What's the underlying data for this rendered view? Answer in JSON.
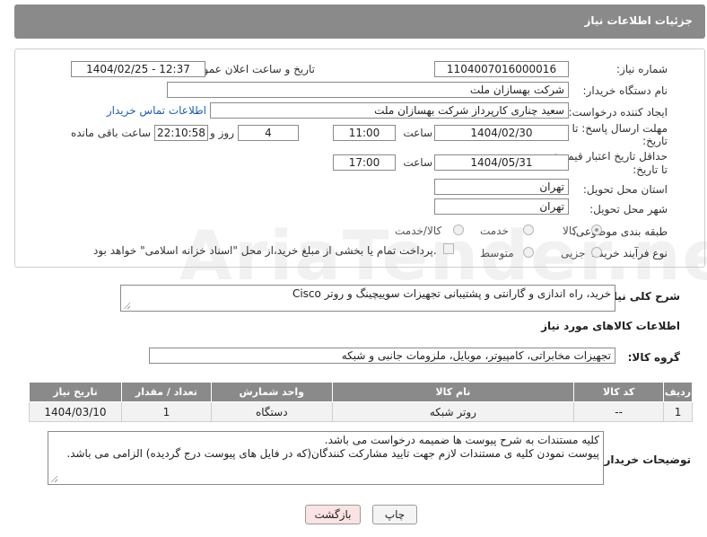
{
  "header": {
    "title": "جزئیات اطلاعات نیاز"
  },
  "form": {
    "need_number_label": "شماره نیاز:",
    "need_number": "1104007016000016",
    "announce_label": "تاریخ و ساعت اعلان عمومی:",
    "announce_value": "1404/02/25 - 12:37",
    "buyer_org_label": "نام دستگاه خریدار:",
    "buyer_org": "شرکت بهسازان ملت",
    "creator_label": "ایجاد کننده درخواست:",
    "creator": "سعید چناری کارپرداز شرکت بهسازان ملت",
    "contact_link": "اطلاعات تماس خریدار",
    "deadline_label_1": "مهلت ارسال پاسخ: تا",
    "deadline_label_2": "تاریخ:",
    "deadline_date": "1404/02/30",
    "time_label": "ساعت",
    "deadline_time": "11:00",
    "days_value": "4",
    "days_label": "روز و",
    "remaining_time": "22:10:58",
    "remaining_label": "ساعت باقی مانده",
    "min_price_label_1": "حداقل تاریخ اعتبار قیمت:",
    "min_price_label_2": "تا تاریخ:",
    "min_price_date": "1404/05/31",
    "min_price_time": "17:00",
    "province_label": "استان محل تحویل:",
    "province": "تهران",
    "city_label": "شهر محل تحویل:",
    "city": "تهران",
    "category_label": "طبقه بندی موضوعی:",
    "category_options": [
      "کالا",
      "خدمت",
      "کالا/خدمت"
    ],
    "category_selected": "کالا",
    "purchase_type_label": "نوع فرآیند خرید :",
    "purchase_options": [
      "جزیی",
      "متوسط"
    ],
    "payment_note": "پرداخت تمام یا بخشی از مبلغ خرید،از محل \"اسناد خزانه اسلامی\" خواهد بود."
  },
  "description": {
    "label": "شرح کلی نیاز:",
    "text": "خرید، راه اندازی و گارانتی و پشتیبانی تجهیزات سوییچینگ و روتر Cisco"
  },
  "goods": {
    "section_title": "اطلاعات کالاهای مورد نیاز",
    "group_label": "گروه کالا:",
    "group_value": "تجهیزات مخابراتی، کامپیوتر، موبایل، ملزومات جانبی و شبکه",
    "columns": [
      "ردیف",
      "کد کالا",
      "نام کالا",
      "واحد شمارش",
      "تعداد / مقدار",
      "تاریخ نیاز"
    ],
    "rows": [
      [
        "1",
        "--",
        "روتر شبکه",
        "دستگاه",
        "1",
        "1404/03/10"
      ]
    ]
  },
  "buyer_notes": {
    "label": "توضیحات خریدار:",
    "line1": "کلیه مستندات به شرح پیوست ها ضمیمه درخواست می باشد.",
    "line2": "پیوست نمودن کلیه ی مستندات لازم جهت تایید مشارکت کنندگان(که در فایل های پیوست درج گردیده) الزامی می باشد."
  },
  "buttons": {
    "print": "چاپ",
    "back": "بازگشت"
  },
  "watermark": "AriaTender.neT",
  "colors": {
    "header_bg": "#8a8a8a",
    "link": "#1a5fb4",
    "back_button_bg": "#fbe3e3"
  }
}
